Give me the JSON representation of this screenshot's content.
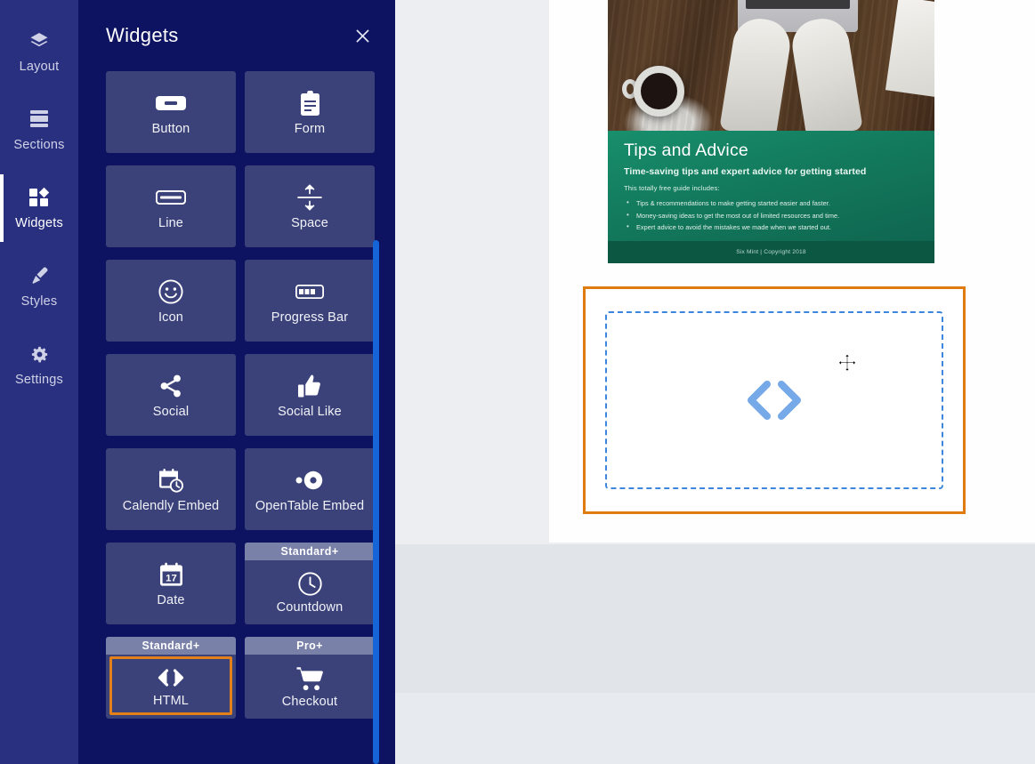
{
  "rail": {
    "items": [
      {
        "label": "Layout",
        "icon": "layers-icon",
        "active": false
      },
      {
        "label": "Sections",
        "icon": "sections-icon",
        "active": false
      },
      {
        "label": "Widgets",
        "icon": "widgets-icon",
        "active": true
      },
      {
        "label": "Styles",
        "icon": "brush-icon",
        "active": false
      },
      {
        "label": "Settings",
        "icon": "gear-icon",
        "active": false
      }
    ]
  },
  "panel": {
    "title": "Widgets",
    "close_icon": "close-icon",
    "scrollbar_color": "#1565d8",
    "widgets": [
      {
        "label": "Button",
        "icon": "button-icon",
        "badge": null,
        "selected": false
      },
      {
        "label": "Form",
        "icon": "clipboard-icon",
        "badge": null,
        "selected": false
      },
      {
        "label": "Line",
        "icon": "line-icon",
        "badge": null,
        "selected": false
      },
      {
        "label": "Space",
        "icon": "space-icon",
        "badge": null,
        "selected": false
      },
      {
        "label": "Icon",
        "icon": "smiley-icon",
        "badge": null,
        "selected": false
      },
      {
        "label": "Progress Bar",
        "icon": "progress-icon",
        "badge": null,
        "selected": false
      },
      {
        "label": "Social",
        "icon": "share-icon",
        "badge": null,
        "selected": false
      },
      {
        "label": "Social Like",
        "icon": "thumbs-up-icon",
        "badge": null,
        "selected": false
      },
      {
        "label": "Calendly Embed",
        "icon": "calendar-clock-icon",
        "badge": null,
        "selected": false
      },
      {
        "label": "OpenTable Embed",
        "icon": "opentable-icon",
        "badge": null,
        "selected": false
      },
      {
        "label": "Date",
        "icon": "calendar-17-icon",
        "badge": null,
        "selected": false
      },
      {
        "label": "Countdown",
        "icon": "clock-icon",
        "badge": "Standard+",
        "selected": false
      },
      {
        "label": "HTML",
        "icon": "code-icon",
        "badge": "Standard+",
        "selected": true
      },
      {
        "label": "Checkout",
        "icon": "cart-icon",
        "badge": "Pro+",
        "selected": false
      }
    ]
  },
  "canvas": {
    "hero_card": {
      "photo_alt": "hands typing on laptop with coffee cup on wooden desk",
      "heading": "Tips and Advice",
      "subheading": "Time-saving tips and expert advice for getting started",
      "lead": "This totally free guide includes:",
      "bullets": [
        "Tips & recommendations to make getting started easier and faster.",
        "Money-saving ideas to get the most out of limited resources and time.",
        "Expert advice to avoid the mistakes we made when we started out."
      ],
      "footer": "Six Mint | Copyright 2018"
    },
    "dropzone": {
      "icon": "code-icon",
      "outline_color": "#e07b10",
      "dash_color": "#3c87dd",
      "cursor": "move-cursor"
    }
  }
}
